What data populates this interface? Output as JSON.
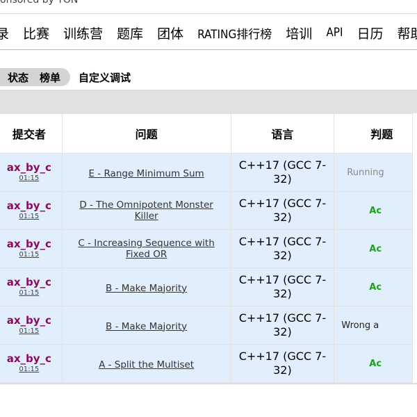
{
  "header": {
    "sponsor_text": "onsored by TON"
  },
  "nav": {
    "items": [
      "录",
      "比赛",
      "训练营",
      "题库",
      "团体",
      "RATING排行榜",
      "培训",
      "API",
      "日历",
      "帮助"
    ]
  },
  "subtabs": {
    "items": [
      "状态",
      "榜单",
      "自定义调试"
    ]
  },
  "table": {
    "headers": [
      "提交者",
      "问题",
      "语言",
      "判题"
    ],
    "rows": [
      {
        "who": "ax_by_c",
        "time": "01:15",
        "problem": "E - Range Minimum Sum",
        "language": "C++17 (GCC 7-32)",
        "verdict": "Running"
      },
      {
        "who": "ax_by_c",
        "time": "01:15",
        "problem": "D - The Omnipotent Monster Killer",
        "language": "C++17 (GCC 7-32)",
        "verdict": "Ac"
      },
      {
        "who": "ax_by_c",
        "time": "01:15",
        "problem": "C - Increasing Sequence with Fixed OR",
        "language": "C++17 (GCC 7-32)",
        "verdict": "Ac"
      },
      {
        "who": "ax_by_c",
        "time": "01:15",
        "problem": "B - Make Majority",
        "language": "C++17 (GCC 7-32)",
        "verdict": "Ac"
      },
      {
        "who": "ax_by_c",
        "time": "01:15",
        "problem": "B - Make Majority",
        "language": "C++17 (GCC 7-32)",
        "verdict": "Wrong a"
      },
      {
        "who": "ax_by_c",
        "time": "01:15",
        "problem": "A - Split the Multiset",
        "language": "C++17 (GCC 7-32)",
        "verdict": "Ac"
      }
    ]
  },
  "colors": {
    "row_bg": "#e1eefb",
    "handle": "#8b0a62",
    "accepted": "#1aa31a",
    "running": "#888888"
  }
}
